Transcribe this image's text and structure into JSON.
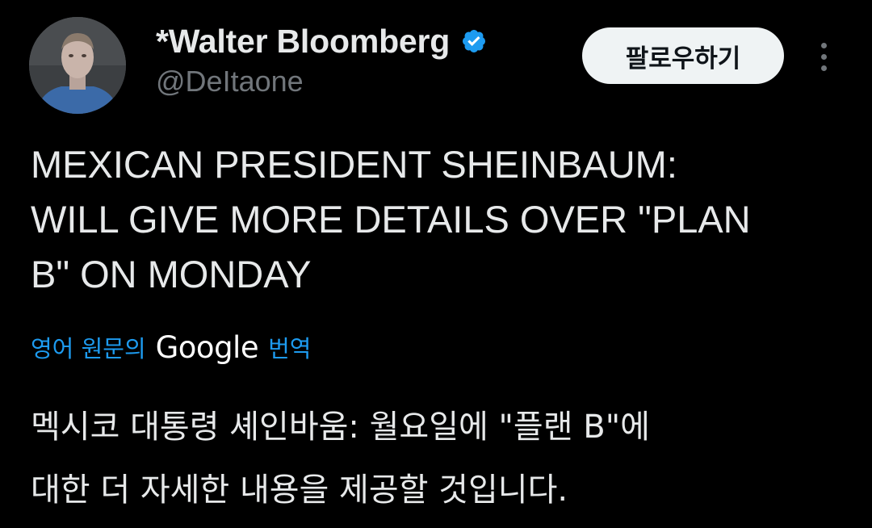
{
  "author": {
    "display_name": "*Walter Bloomberg",
    "handle": "@DeItaone",
    "verified": true
  },
  "actions": {
    "follow_label": "팔로우하기"
  },
  "icons": {
    "verified": "verified-badge-icon",
    "more": "more-options-icon"
  },
  "tweet": {
    "lines": [
      "MEXICAN PRESIDENT SHEINBAUM:",
      "WILL GIVE MORE DETAILS OVER \"PLAN",
      "B\" ON MONDAY"
    ]
  },
  "translation_bar": {
    "prefix": "영어 원문의",
    "brand": "Google",
    "suffix": "번역"
  },
  "translation": {
    "lines": [
      "멕시코 대통령 셰인바움: 월요일에 \"플랜 B\"에",
      "대한 더 자세한 내용을 제공할 것입니다."
    ]
  },
  "colors": {
    "background": "#000000",
    "text": "#e7e9ea",
    "secondary": "#71767b",
    "accent": "#1d9bf0",
    "button_bg": "#eff3f4"
  }
}
